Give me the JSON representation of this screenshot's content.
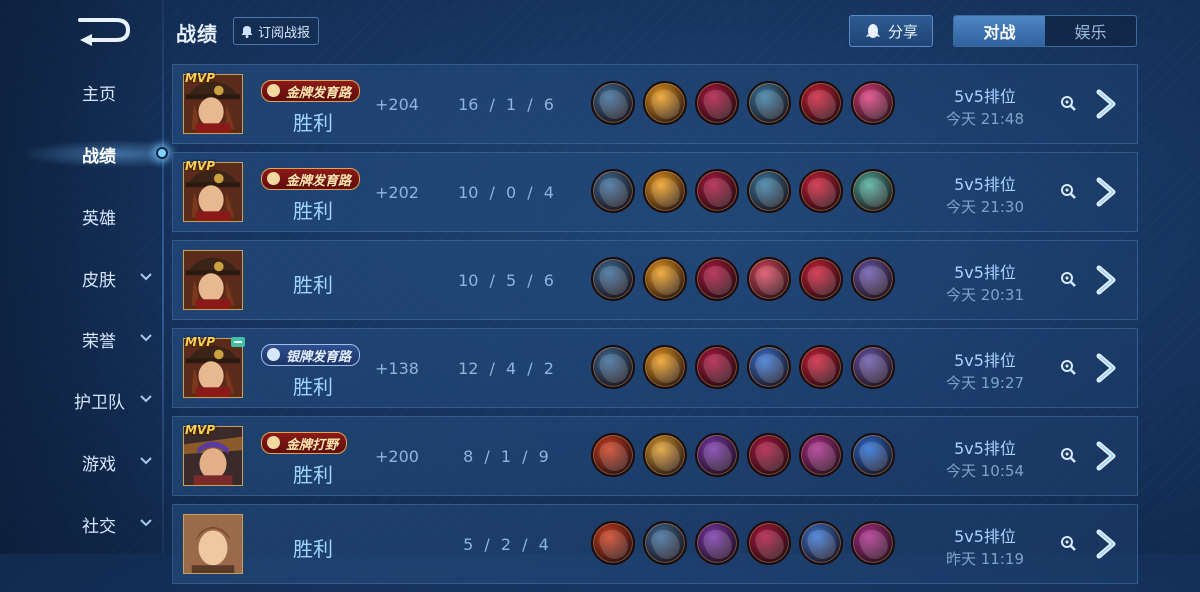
{
  "header": {
    "title": "战绩",
    "subscribe_label": "订阅战报",
    "share_label": "分享",
    "tabs": [
      {
        "label": "对战",
        "active": true
      },
      {
        "label": "娱乐",
        "active": false
      }
    ]
  },
  "sidebar": {
    "items": [
      {
        "label": "主页",
        "chevron": false,
        "active": false
      },
      {
        "label": "战绩",
        "chevron": false,
        "active": true
      },
      {
        "label": "英雄",
        "chevron": false,
        "active": false
      },
      {
        "label": "皮肤",
        "chevron": true,
        "active": false
      },
      {
        "label": "荣誉",
        "chevron": true,
        "active": false
      },
      {
        "label": "护卫队",
        "chevron": true,
        "active": false
      },
      {
        "label": "游戏",
        "chevron": true,
        "active": false
      },
      {
        "label": "社交",
        "chevron": true,
        "active": false
      }
    ]
  },
  "matches": [
    {
      "mvp": "MVP",
      "tag": "金牌发育路",
      "tag_type": "gold",
      "result": "胜利",
      "score": "+204",
      "kda": "16 / 1 / 6",
      "mode": "5v5排位",
      "time": "今天 21:48",
      "hero": "hero-a",
      "items": [
        "#3d6f9c",
        "#f0a020",
        "#b01840",
        "#3a7fa8",
        "#d0203a",
        "#e04080"
      ]
    },
    {
      "mvp": "MVP",
      "tag": "金牌发育路",
      "tag_type": "gold",
      "result": "胜利",
      "score": "+202",
      "kda": "10 / 0 / 4",
      "mode": "5v5排位",
      "time": "今天 21:30",
      "hero": "hero-a",
      "items": [
        "#3d6f9c",
        "#f0a020",
        "#b01840",
        "#3a7fa8",
        "#d0203a",
        "#4fb0a0"
      ]
    },
    {
      "mvp": "",
      "tag": "",
      "tag_type": "",
      "result": "胜利",
      "score": "",
      "kda": "10 / 5 / 6",
      "mode": "5v5排位",
      "time": "今天 20:31",
      "hero": "hero-a",
      "items": [
        "#3d6f9c",
        "#f0a020",
        "#b01840",
        "#e04a60",
        "#d0203a",
        "#6a5ab0"
      ]
    },
    {
      "mvp": "MVP",
      "tag": "银牌发育路",
      "tag_type": "silver",
      "result": "胜利",
      "score": "+138",
      "kda": "12 / 4 / 2",
      "mode": "5v5排位",
      "time": "今天 19:27",
      "hero": "hero-a",
      "badge": true,
      "items": [
        "#3d6f9c",
        "#f0a020",
        "#b01840",
        "#3a78d8",
        "#d0203a",
        "#6a5ab0"
      ]
    },
    {
      "mvp": "MVP",
      "tag": "金牌打野",
      "tag_type": "gold",
      "result": "胜利",
      "score": "+200",
      "kda": "8 / 1 / 9",
      "mode": "5v5排位",
      "time": "今天 10:54",
      "hero": "hero-b",
      "items": [
        "#d04020",
        "#e0a030",
        "#7a3ab0",
        "#b01840",
        "#b03090",
        "#2a70d8"
      ]
    },
    {
      "mvp": "",
      "tag": "",
      "tag_type": "",
      "result": "胜利",
      "score": "",
      "kda": "5 / 2 / 4",
      "mode": "5v5排位",
      "time": "昨天 11:19",
      "hero": "hero-c",
      "items": [
        "#d04020",
        "#3d6f9c",
        "#7a3ab0",
        "#b01840",
        "#3a78d8",
        "#b03090"
      ]
    }
  ]
}
